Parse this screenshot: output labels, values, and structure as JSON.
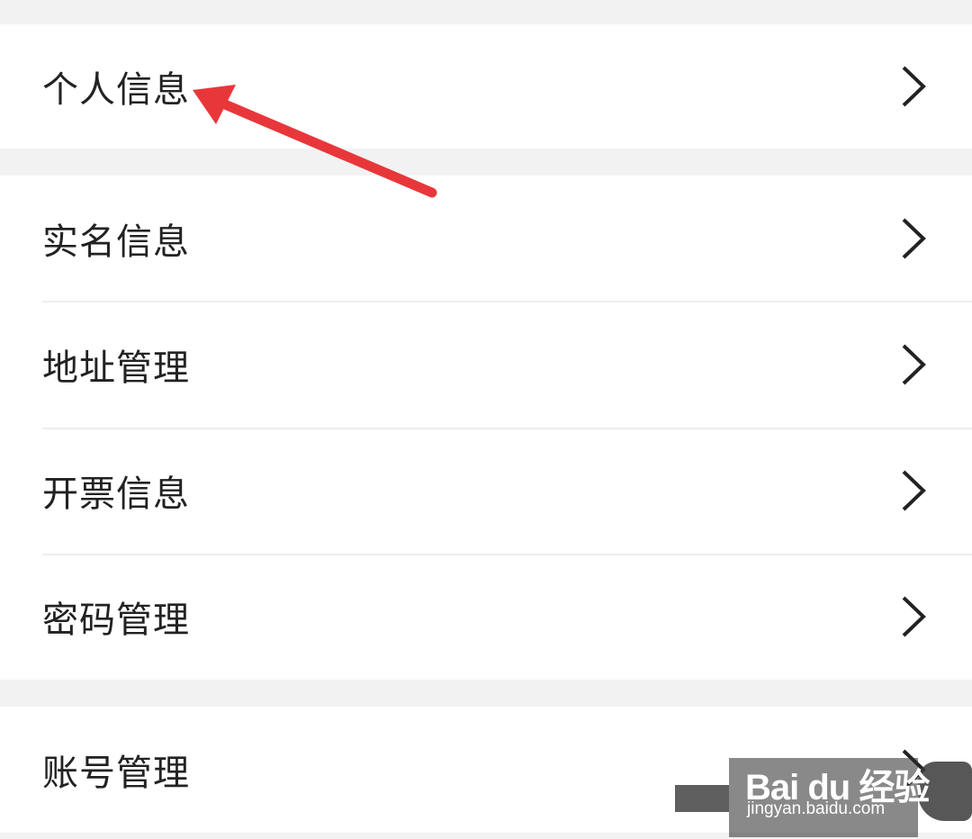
{
  "groups": [
    {
      "items": [
        {
          "label": "个人信息"
        }
      ]
    },
    {
      "items": [
        {
          "label": "实名信息"
        },
        {
          "label": "地址管理"
        },
        {
          "label": "开票信息"
        },
        {
          "label": "密码管理"
        }
      ]
    },
    {
      "items": [
        {
          "label": "账号管理"
        }
      ]
    }
  ],
  "watermark": {
    "logo": "Bai du 经验",
    "url": "jingyan.baidu.com"
  },
  "colors": {
    "text": "#222222",
    "annotation_arrow": "#e8373a",
    "background": "#f2f2f2"
  },
  "icons": {
    "row_chevron": "chevron-right-icon"
  }
}
